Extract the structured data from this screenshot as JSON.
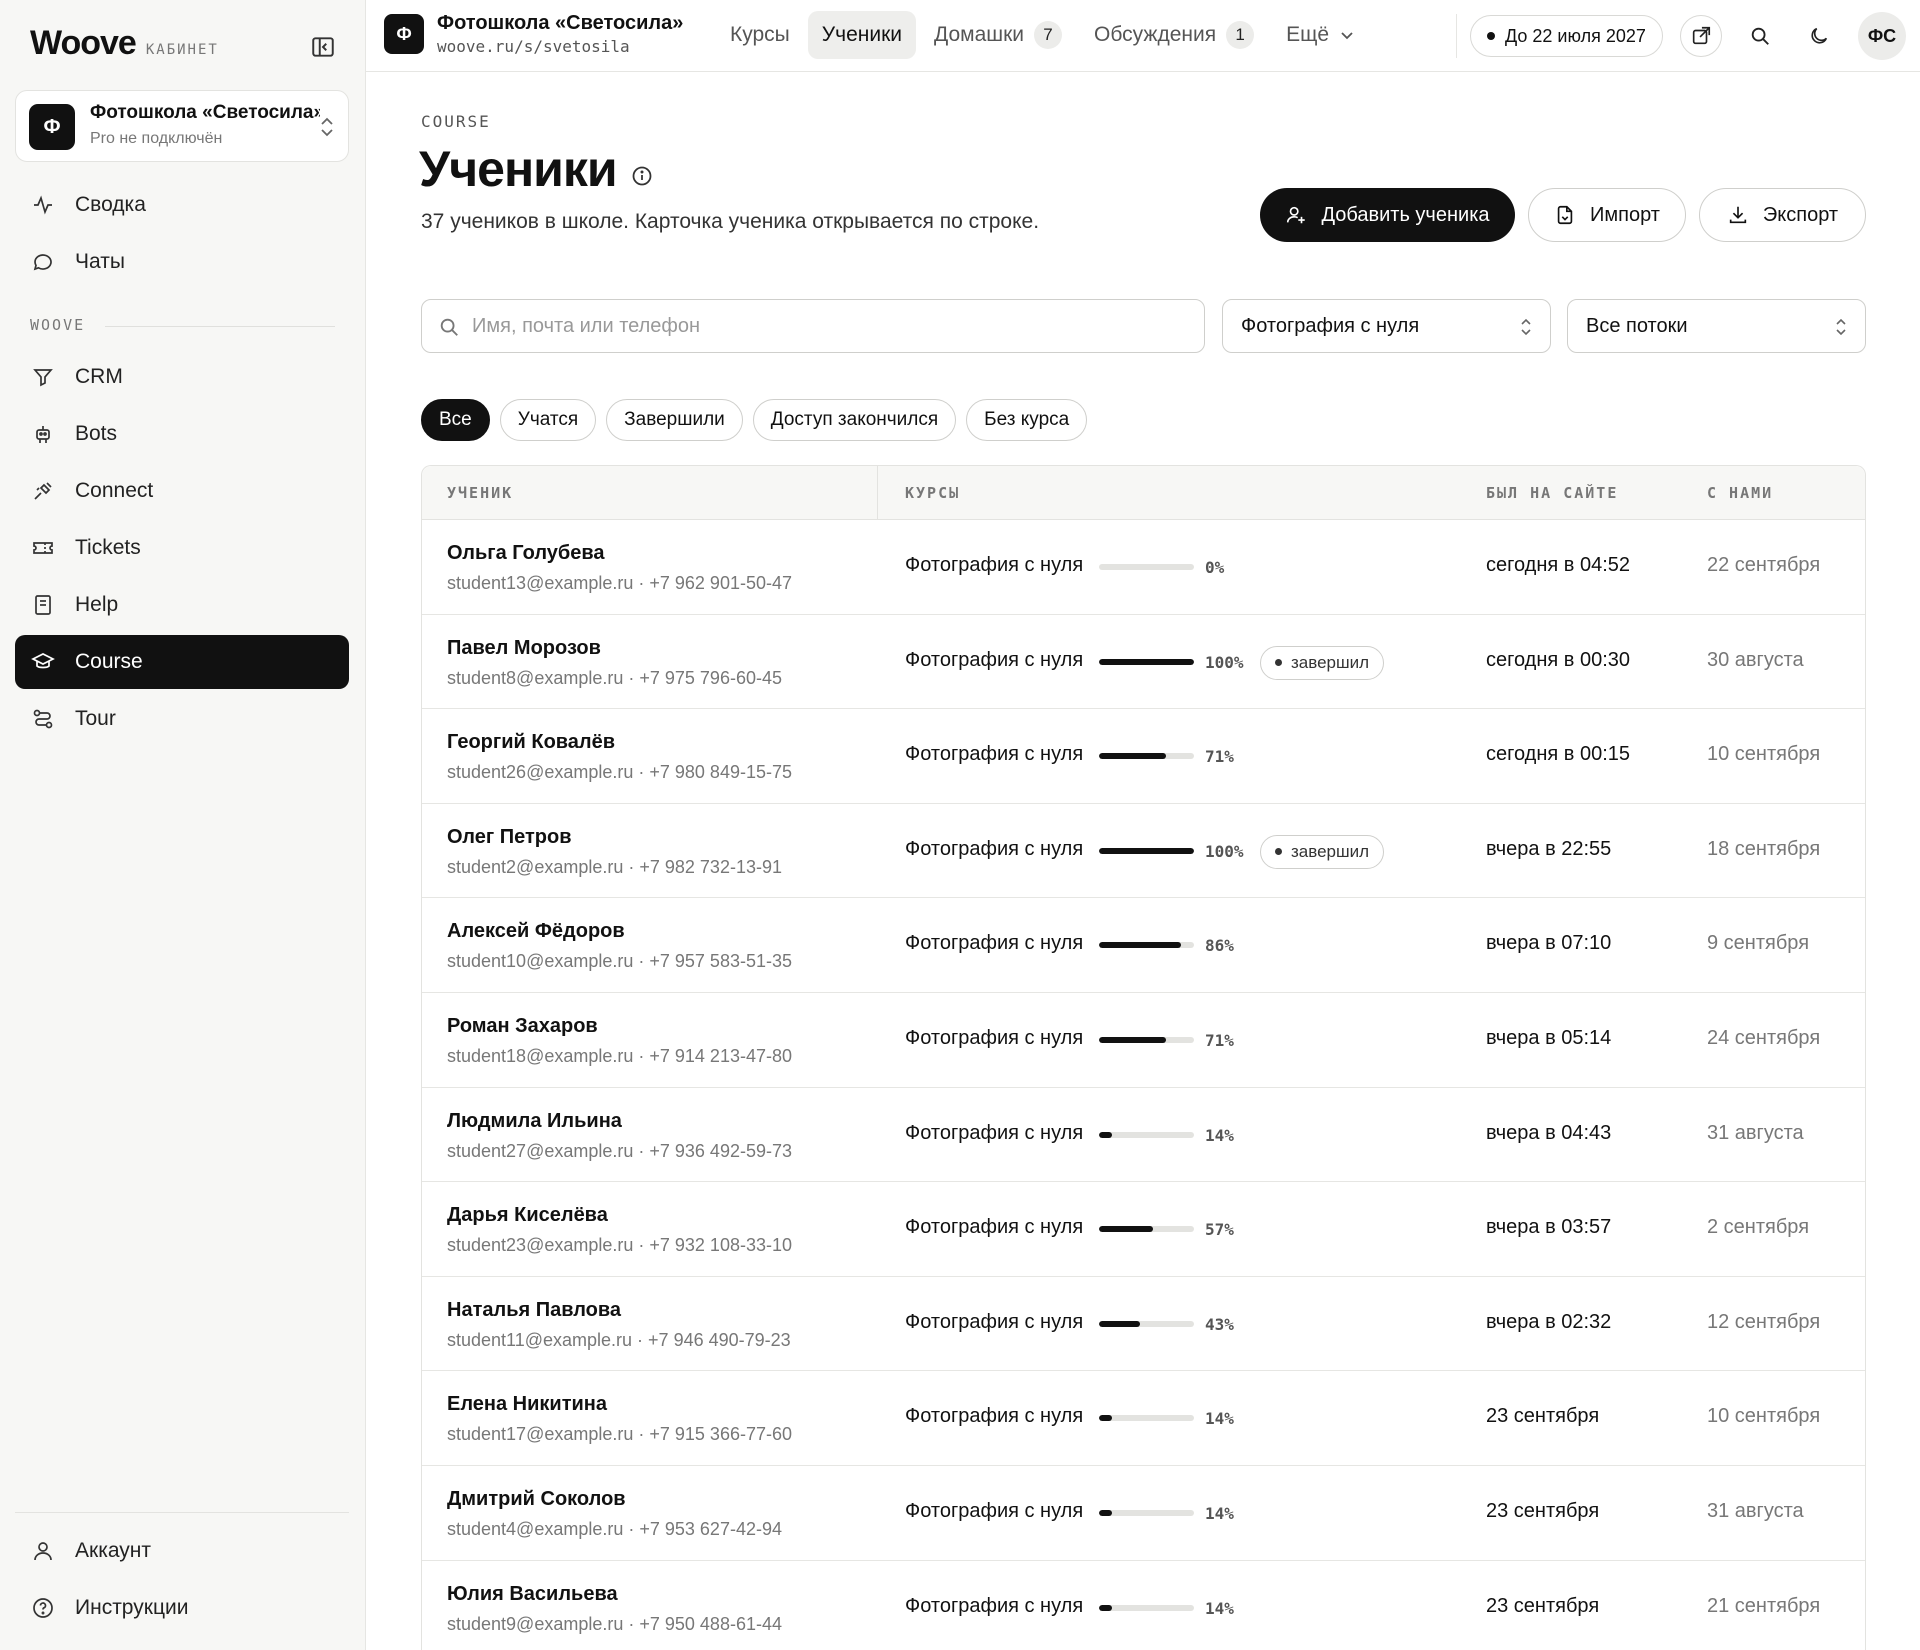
{
  "sidebar": {
    "brand": "Woove",
    "brand_sub": "КАБИНЕТ",
    "org": {
      "avatar": "Ф",
      "name": "Фотошкола «Светосила»",
      "sub": "Pro не подключён"
    },
    "section": "WOOVE",
    "items_top": [
      {
        "label": "Сводка",
        "icon": "activity-icon"
      },
      {
        "label": "Чаты",
        "icon": "chat-bubble-icon"
      }
    ],
    "items": [
      {
        "label": "CRM",
        "icon": "funnel-icon"
      },
      {
        "label": "Bots",
        "icon": "bot-icon"
      },
      {
        "label": "Connect",
        "icon": "plug-icon"
      },
      {
        "label": "Tickets",
        "icon": "ticket-icon"
      },
      {
        "label": "Help",
        "icon": "book-icon"
      },
      {
        "label": "Course",
        "icon": "graduation-cap-icon",
        "active": true
      },
      {
        "label": "Tour",
        "icon": "route-icon"
      }
    ],
    "footer": [
      {
        "label": "Аккаунт",
        "icon": "user-icon"
      },
      {
        "label": "Инструкции",
        "icon": "help-circle-icon"
      }
    ]
  },
  "topbar": {
    "school_avatar": "Ф",
    "school_name": "Фотошкола «Светосила»",
    "school_url": "woove.ru/s/svetosila",
    "tabs": [
      {
        "label": "Курсы"
      },
      {
        "label": "Ученики",
        "active": true
      },
      {
        "label": "Домашки",
        "count": "7"
      },
      {
        "label": "Обсуждения",
        "count": "1"
      },
      {
        "label": "Ещё",
        "dropdown": true
      }
    ],
    "access_label": "До 22 июля 2027",
    "user_initials": "ФС"
  },
  "main": {
    "eyebrow": "COURSE",
    "title": "Ученики",
    "subtitle": "37 учеников в школе. Карточка ученика открывается по строке.",
    "buttons": {
      "add": "Добавить ученика",
      "import": "Импорт",
      "export": "Экспорт"
    },
    "search": {
      "placeholder": "Имя, почта или телефон",
      "value": ""
    },
    "course_filter": "Фотография с нуля",
    "stream_filter": "Все потоки",
    "chips": [
      {
        "label": "Все",
        "active": true
      },
      {
        "label": "Учатся"
      },
      {
        "label": "Завершили"
      },
      {
        "label": "Доступ закончился"
      },
      {
        "label": "Без курса"
      }
    ]
  },
  "table": {
    "headers": {
      "student": "УЧЕНИК",
      "courses": "КУРСЫ",
      "last_seen": "БЫЛ НА САЙТЕ",
      "since": "С НАМИ"
    },
    "done_label": "завершил",
    "rows": [
      {
        "name": "Ольга Голубева",
        "contact": "student13@example.ru · +7 962 901-50-47",
        "course": "Фотография с нуля",
        "progress": 0,
        "progress_label": "0%",
        "done": false,
        "last_seen": "сегодня в 04:52",
        "since": "22 сентября"
      },
      {
        "name": "Павел Морозов",
        "contact": "student8@example.ru · +7 975 796-60-45",
        "course": "Фотография с нуля",
        "progress": 100,
        "progress_label": "100%",
        "done": true,
        "last_seen": "сегодня в 00:30",
        "since": "30 августа"
      },
      {
        "name": "Георгий Ковалёв",
        "contact": "student26@example.ru · +7 980 849-15-75",
        "course": "Фотография с нуля",
        "progress": 71,
        "progress_label": "71%",
        "done": false,
        "last_seen": "сегодня в 00:15",
        "since": "10 сентября"
      },
      {
        "name": "Олег Петров",
        "contact": "student2@example.ru · +7 982 732-13-91",
        "course": "Фотография с нуля",
        "progress": 100,
        "progress_label": "100%",
        "done": true,
        "last_seen": "вчера в 22:55",
        "since": "18 сентября"
      },
      {
        "name": "Алексей Фёдоров",
        "contact": "student10@example.ru · +7 957 583-51-35",
        "course": "Фотография с нуля",
        "progress": 86,
        "progress_label": "86%",
        "done": false,
        "last_seen": "вчера в 07:10",
        "since": "9 сентября"
      },
      {
        "name": "Роман Захаров",
        "contact": "student18@example.ru · +7 914 213-47-80",
        "course": "Фотография с нуля",
        "progress": 71,
        "progress_label": "71%",
        "done": false,
        "last_seen": "вчера в 05:14",
        "since": "24 сентября"
      },
      {
        "name": "Людмила Ильина",
        "contact": "student27@example.ru · +7 936 492-59-73",
        "course": "Фотография с нуля",
        "progress": 14,
        "progress_label": "14%",
        "done": false,
        "last_seen": "вчера в 04:43",
        "since": "31 августа"
      },
      {
        "name": "Дарья Киселёва",
        "contact": "student23@example.ru · +7 932 108-33-10",
        "course": "Фотография с нуля",
        "progress": 57,
        "progress_label": "57%",
        "done": false,
        "last_seen": "вчера в 03:57",
        "since": "2 сентября"
      },
      {
        "name": "Наталья Павлова",
        "contact": "student11@example.ru · +7 946 490-79-23",
        "course": "Фотография с нуля",
        "progress": 43,
        "progress_label": "43%",
        "done": false,
        "last_seen": "вчера в 02:32",
        "since": "12 сентября"
      },
      {
        "name": "Елена Никитина",
        "contact": "student17@example.ru · +7 915 366-77-60",
        "course": "Фотография с нуля",
        "progress": 14,
        "progress_label": "14%",
        "done": false,
        "last_seen": "23 сентября",
        "since": "10 сентября"
      },
      {
        "name": "Дмитрий Соколов",
        "contact": "student4@example.ru · +7 953 627-42-94",
        "course": "Фотография с нуля",
        "progress": 14,
        "progress_label": "14%",
        "done": false,
        "last_seen": "23 сентября",
        "since": "31 августа"
      },
      {
        "name": "Юлия Васильева",
        "contact": "student9@example.ru · +7 950 488-61-44",
        "course": "Фотография с нуля",
        "progress": 14,
        "progress_label": "14%",
        "done": false,
        "last_seen": "23 сентября",
        "since": "21 сентября"
      }
    ]
  }
}
